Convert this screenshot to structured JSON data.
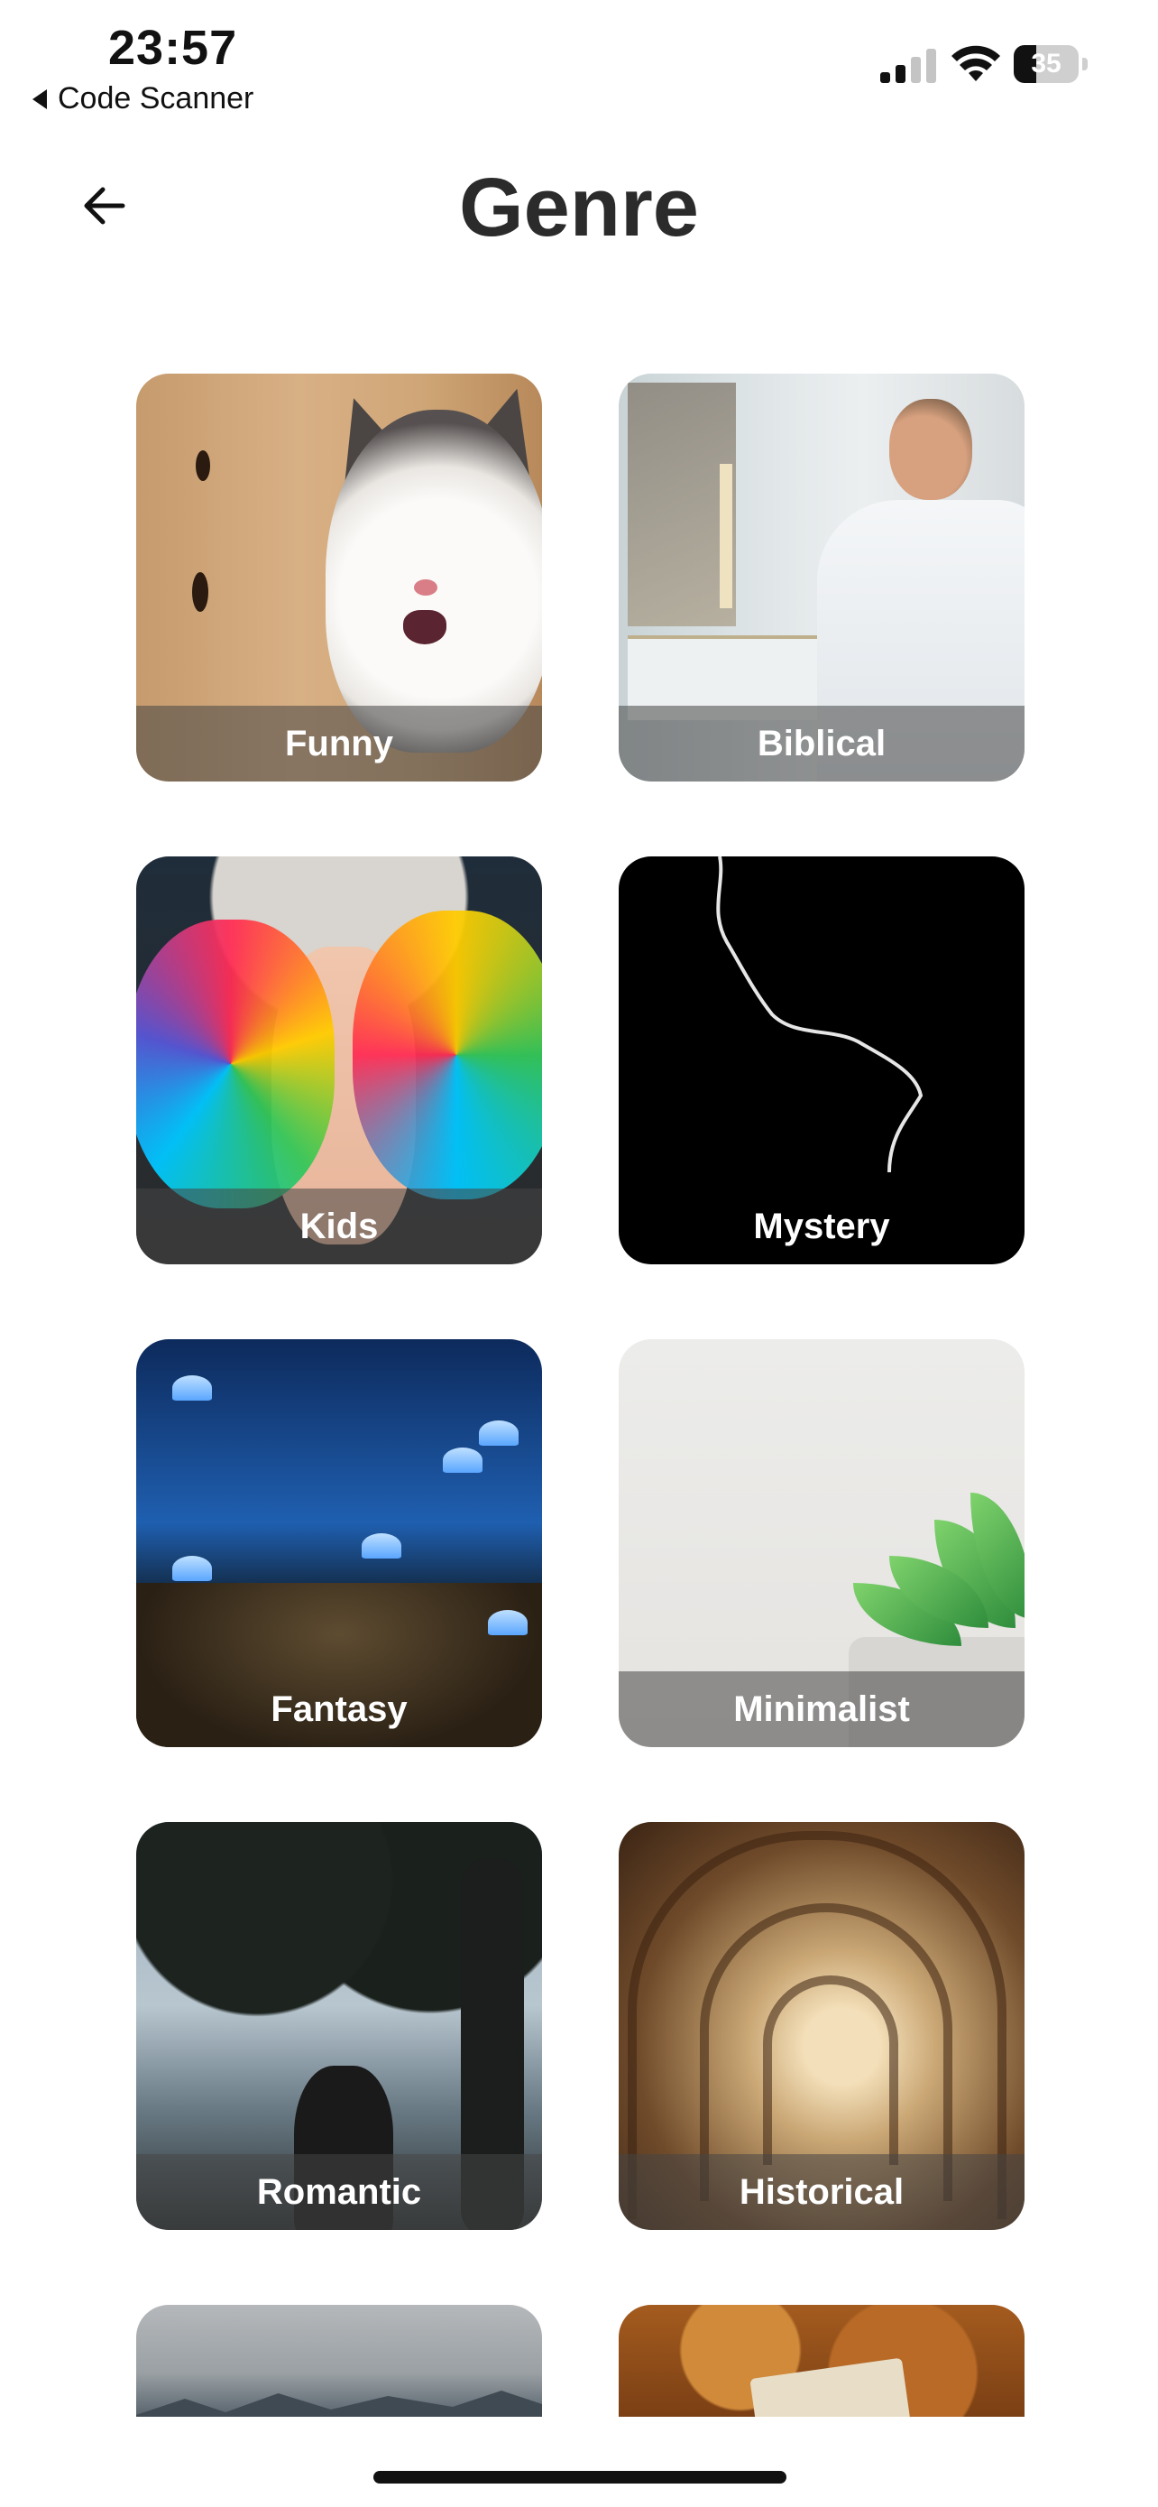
{
  "status_bar": {
    "time": "23:57",
    "back_to_app": "Code Scanner",
    "battery_percent": "35",
    "battery_level": 0.35
  },
  "header": {
    "title": "Genre"
  },
  "genres": [
    {
      "label": "Funny"
    },
    {
      "label": "Biblical"
    },
    {
      "label": "Kids"
    },
    {
      "label": "Mystery"
    },
    {
      "label": "Fantasy"
    },
    {
      "label": "Minimalist"
    },
    {
      "label": "Romantic"
    },
    {
      "label": "Historical"
    }
  ],
  "colors": {
    "title_text": "#2b2b2b",
    "label_overlay": "#464646",
    "background": "#ffffff"
  },
  "icons": {
    "back": "arrow-left-icon",
    "signal": "cellular-signal-icon",
    "wifi": "wifi-icon",
    "battery": "battery-icon"
  }
}
